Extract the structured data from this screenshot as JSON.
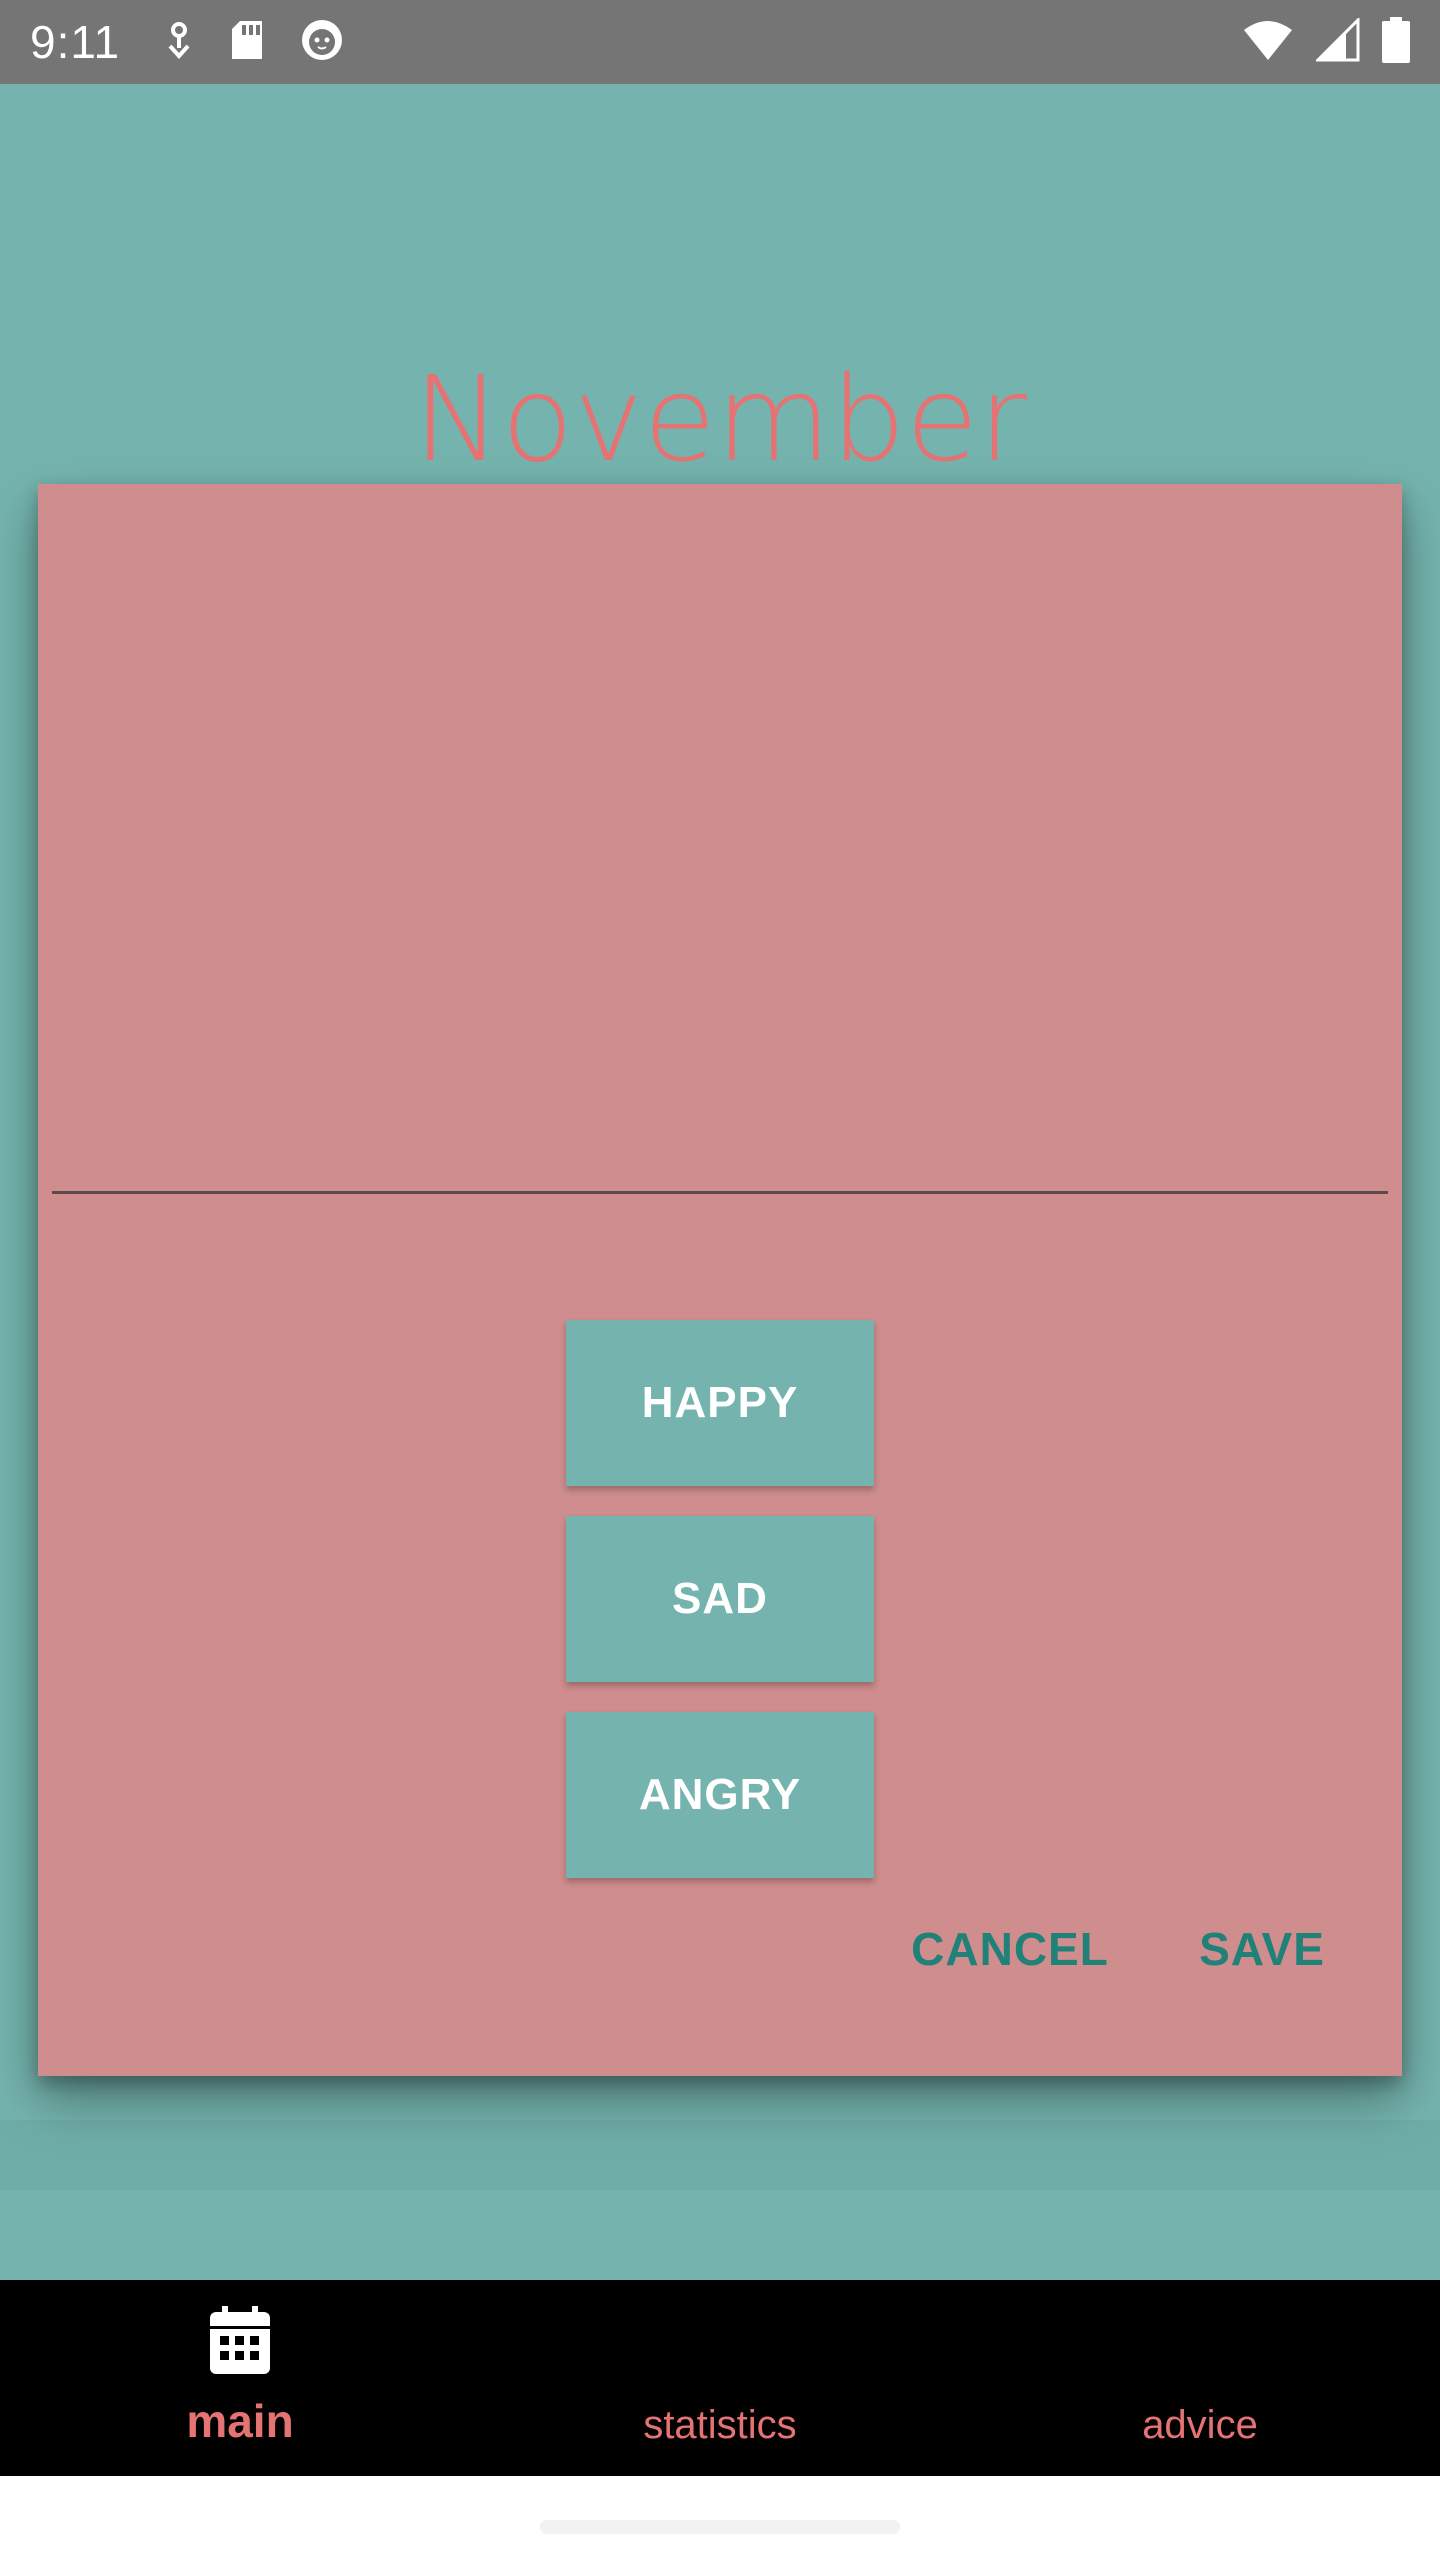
{
  "status_bar": {
    "time": "9:11",
    "left_icons": [
      "download-icon",
      "sd-card-icon",
      "cat-face-icon"
    ],
    "right_icons": [
      "wifi-icon",
      "signal-icon",
      "battery-icon"
    ]
  },
  "header": {
    "month": "November"
  },
  "dialog": {
    "note_value": "",
    "mood_buttons": [
      {
        "label": "HAPPY"
      },
      {
        "label": "SAD"
      },
      {
        "label": "ANGRY"
      }
    ],
    "cancel_label": "CANCEL",
    "save_label": "SAVE"
  },
  "bottom_nav": {
    "items": [
      {
        "label": "main",
        "icon": "calendar-icon",
        "active": true
      },
      {
        "label": "statistics",
        "active": false
      },
      {
        "label": "advice",
        "active": false
      }
    ]
  },
  "colors": {
    "app_background": "#75b4ae",
    "dialog_background": "#cf8d8d",
    "accent_text": "#e57373",
    "action_text": "#1f8178",
    "nav_background": "#000000",
    "status_bar": "#757575"
  }
}
